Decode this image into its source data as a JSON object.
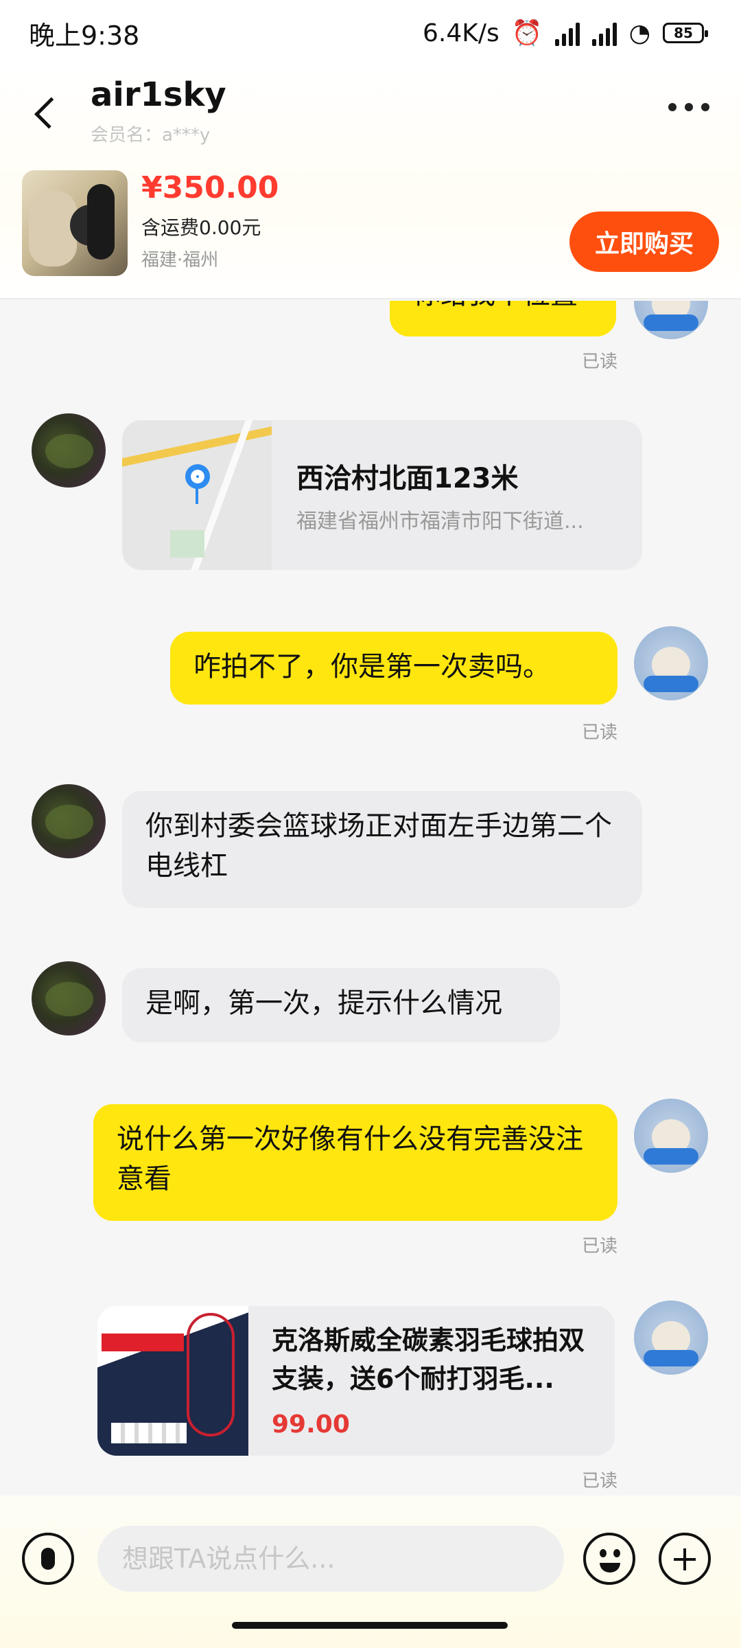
{
  "status_bar": {
    "time": "晚上9:38",
    "speed": "6.4K/s",
    "battery": "85"
  },
  "header": {
    "peer_name": "air1sky",
    "member_label": "会员名：a***y"
  },
  "product": {
    "price": "¥350.00",
    "shipping": "含运费0.00元",
    "location": "福建·福州",
    "buy_label": "立即购买"
  },
  "messages": {
    "m0_text": "你给我个位置",
    "m0_read": "已读",
    "location_title": "西洽村北面123米",
    "location_address": "福建省福州市福清市阳下街道...",
    "m2_text": "咋拍不了，你是第一次卖吗。",
    "m2_read": "已读",
    "m3_text": "你到村委会篮球场正对面左手边第二个电线杠",
    "m4_text": "是啊，第一次，提示什么情况",
    "m5_text": "说什么第一次好像有什么没有完善没注意看",
    "m5_read": "已读",
    "product_card_title": "克洛斯威全碳素羽毛球拍双支装，送6个耐打羽毛...",
    "product_card_price": "99.00",
    "product_card_read": "已读"
  },
  "input": {
    "placeholder": "想跟TA说点什么..."
  },
  "colors": {
    "accent_yellow": "#ffe60f",
    "buy_orange": "#ff4f0e",
    "price_red": "#ff3b30"
  }
}
